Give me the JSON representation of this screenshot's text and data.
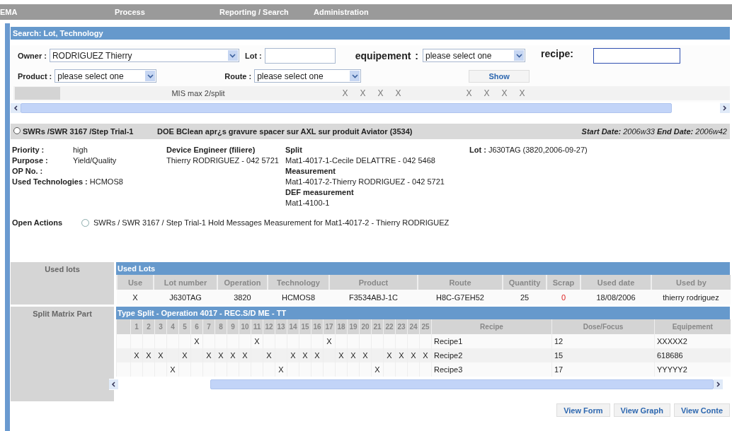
{
  "nav": {
    "items": [
      "EMA",
      "Process",
      "Reporting / Search",
      "Administration"
    ]
  },
  "search": {
    "title": "Search: Lot, Technology",
    "owner": {
      "label": "Owner :",
      "value": "RODRIGUEZ Thierry"
    },
    "lot": {
      "label": "Lot :"
    },
    "equipement": {
      "label": "equipement",
      "separator": ":",
      "value": "please select one"
    },
    "recipe": {
      "label": "recipe:"
    },
    "product": {
      "label": "Product :",
      "value": "please select one"
    },
    "route": {
      "label": "Route :",
      "value": "please select one"
    },
    "show_button": "Show",
    "mis_row": {
      "label": "MIS max 2/split",
      "cells": [
        {
          "text": "X"
        },
        {
          "text": "X"
        },
        {
          "text": "X"
        },
        {
          "text": "X"
        },
        {},
        {},
        {},
        {
          "text": "X"
        },
        {
          "text": "X"
        },
        {
          "text": "X"
        },
        {
          "text": "X"
        }
      ]
    }
  },
  "swr": {
    "selected": false,
    "path": "SWRs /SWR 3167 /Step Trial-1",
    "title": "DOE BClean apr¿s gravure spacer sur AXL sur produit Aviator (3534)",
    "dates": "**Start Date:** 2006w33 **End Date:** 2006w42",
    "fields": [
      {
        "label": "Priority :",
        "value": "high"
      },
      {
        "label": "Purpose :",
        "value": "Yield/Quality"
      },
      {
        "label": "OP No. :"
      }
    ],
    "used_technologies": "**Used Technologies :** HCMOS8",
    "device_engineer": {
      "heading": "Device Engineer (filiere)",
      "value": "Thierry RODRIGUEZ - 042 5721"
    },
    "contacts": [
      {
        "heading": "Split",
        "value": "Mat1-4017-1-Cecile DELATTRE - 042 5468"
      },
      {
        "heading": "Measurement",
        "value": "Mat1-4017-2-Thierry RODRIGUEZ - 042 5721"
      },
      {
        "heading": "DEF measurement",
        "value": "Mat1-4100-1"
      }
    ],
    "lot": "**Lot :** J630TAG (3820,2006-09-27)"
  },
  "open_actions": {
    "label": "Open Actions",
    "items": [
      {
        "selected": false,
        "text": "SWRs / SWR  3167 / Step Trial-1  Hold Messages Measurement for Mat1-4017-2 - Thierry RODRIGUEZ"
      }
    ]
  },
  "used_lots": {
    "side_label": "Used lots",
    "title": "Used Lots",
    "columns": [
      "Use",
      "Lot number",
      "Operation",
      "Technology",
      "Product",
      "Route",
      "Quantity",
      "Scrap",
      "Used date",
      "Used by"
    ],
    "rows": [
      {
        "cells": [
          "X",
          "J630TAG",
          "3820",
          "HCMOS8",
          "F3534ABJ-1C",
          "H8C-G7EH52",
          "25",
          "0",
          "18/08/2006",
          "thierry rodriguez"
        ]
      }
    ]
  },
  "split_matrix": {
    "side_label": "Split Matrix Part",
    "title": "Type Split - Operation 4017 - REC.S/D ME - TT",
    "columns": [
      "1",
      "2",
      "3",
      "4",
      "5",
      "6",
      "7",
      "8",
      "9",
      "10",
      "11",
      "12",
      "13",
      "14",
      "15",
      "16",
      "17",
      "18",
      "19",
      "20",
      "21",
      "22",
      "23",
      "24",
      "25"
    ],
    "extra_columns": [
      "Recipe",
      "Dose/Focus",
      "Equipement"
    ],
    "rows": [
      {
        "cells": [
          {},
          {},
          {},
          {},
          {},
          {
            "text": "X"
          },
          {},
          {},
          {},
          {},
          {
            "text": "X"
          },
          {},
          {},
          {},
          {},
          {},
          {
            "text": "X"
          },
          {},
          {},
          {},
          {},
          {},
          {},
          {},
          {}
        ],
        "recipe": "Recipe1",
        "dose_focus": "12",
        "equipement": "XXXXX2"
      },
      {
        "cells": [
          {
            "text": "X"
          },
          {
            "text": "X"
          },
          {
            "text": "X"
          },
          {},
          {
            "text": "X"
          },
          {},
          {
            "text": "X"
          },
          {
            "text": "X"
          },
          {
            "text": "X"
          },
          {
            "text": "X"
          },
          {},
          {
            "text": "X"
          },
          {},
          {
            "text": "X"
          },
          {
            "text": "X"
          },
          {
            "text": "X"
          },
          {},
          {
            "text": "X"
          },
          {
            "text": "X"
          },
          {
            "text": "X"
          },
          {},
          {
            "text": "X"
          },
          {
            "text": "X"
          },
          {
            "text": "X"
          },
          {
            "text": "X"
          }
        ],
        "recipe": "Recipe2",
        "dose_focus": "15",
        "equipement": "618686"
      },
      {
        "cells": [
          {},
          {},
          {},
          {
            "text": "X"
          },
          {},
          {},
          {},
          {},
          {},
          {},
          {},
          {},
          {
            "text": "X"
          },
          {},
          {},
          {},
          {},
          {},
          {},
          {},
          {
            "text": "X"
          },
          {},
          {},
          {},
          {}
        ],
        "recipe": "Recipe3",
        "dose_focus": "17",
        "equipement": "YYYYY2"
      }
    ]
  },
  "buttons": [
    "View Form",
    "View Graph",
    "View Conte"
  ]
}
